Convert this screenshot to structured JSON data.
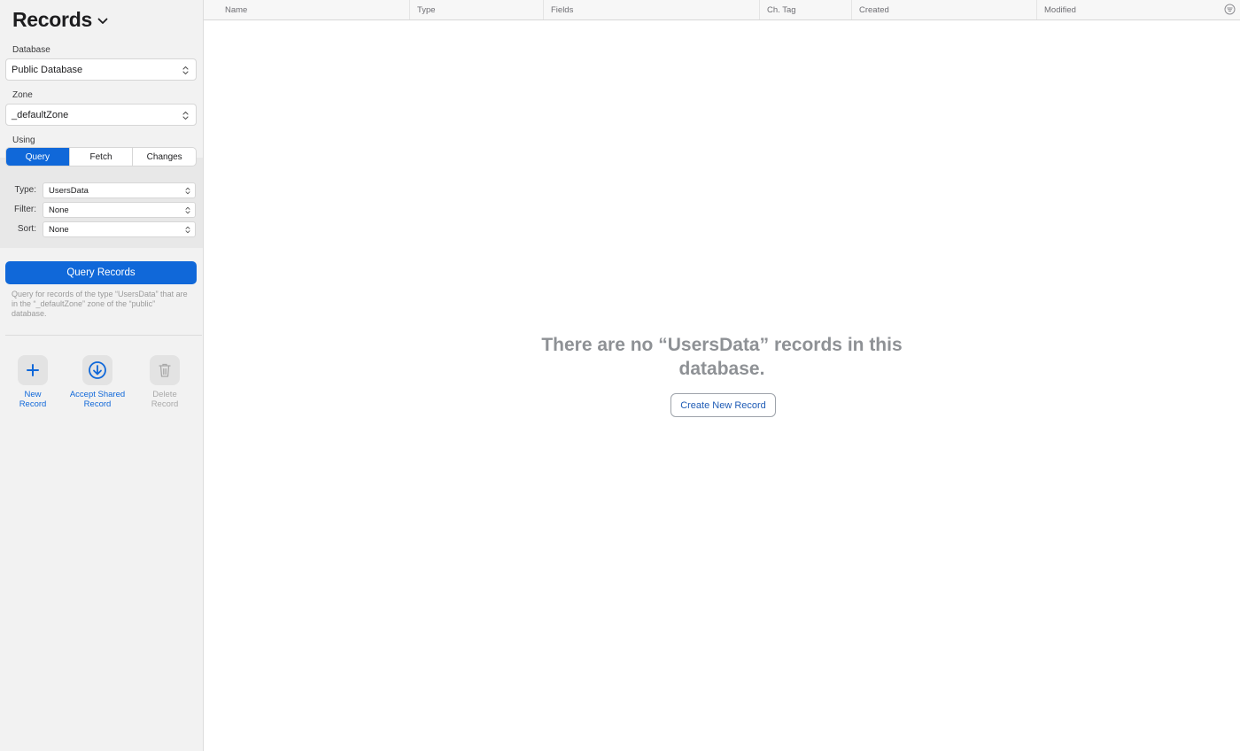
{
  "sidebar": {
    "title": "Records",
    "database": {
      "label": "Database",
      "value": "Public Database"
    },
    "zone": {
      "label": "Zone",
      "value": "_defaultZone"
    },
    "using": {
      "label": "Using",
      "options": [
        "Query",
        "Fetch",
        "Changes"
      ],
      "selected": "Query"
    },
    "query": {
      "type_label": "Type:",
      "type_value": "UsersData",
      "filter_label": "Filter:",
      "filter_value": "None",
      "sort_label": "Sort:",
      "sort_value": "None"
    },
    "query_button": "Query Records",
    "help_text": "Query for records of the type “UsersData” that are in the “_defaultZone” zone of the “public” database.",
    "actions": [
      {
        "label": "New\nRecord",
        "icon": "plus-icon",
        "enabled": true
      },
      {
        "label": "Accept Shared\nRecord",
        "icon": "download-circle-icon",
        "enabled": true
      },
      {
        "label": "Delete\nRecord",
        "icon": "trash-icon",
        "enabled": false
      }
    ]
  },
  "table": {
    "columns": [
      "Name",
      "Type",
      "Fields",
      "Ch. Tag",
      "Created",
      "Modified"
    ]
  },
  "empty_state": {
    "message": "There are no “UsersData” records in this database.",
    "button": "Create New Record"
  },
  "colors": {
    "accent": "#1068d9",
    "sidebar_bg": "#f2f2f2",
    "empty_text": "#8e9195",
    "disabled": "#a9a9a9"
  }
}
